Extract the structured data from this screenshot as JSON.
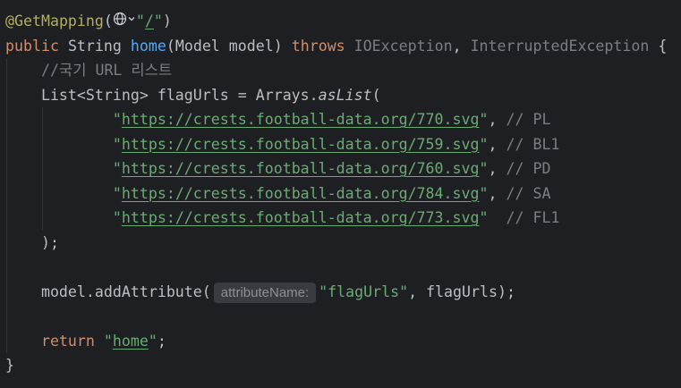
{
  "theme": {
    "background": "#1e1f22",
    "text": "#bcbec4",
    "keyword": "#cf8e6d",
    "method": "#56a8f5",
    "string": "#6aab73",
    "comment": "#7a7e85",
    "annotation": "#b3ae60",
    "unused": "#7a7e85",
    "inlay_bg": "#393b40",
    "inlay_text": "#8c8f94",
    "indent_guide": "#313438",
    "icon": "#ced0d6"
  },
  "icons": {
    "endpoint_actions": "globe-icon",
    "endpoint_dropdown": "chevron-down-icon"
  },
  "inlay_hint": "attributeName:",
  "lines": [
    [
      "@GetMapping",
      "(",
      "\"",
      "/",
      "\"",
      ")"
    ],
    [
      "public",
      " String ",
      "home",
      "(Model model) ",
      "throws",
      " IOException",
      ", ",
      "InterruptedException",
      " {"
    ],
    [
      "//국기 URL 리스트"
    ],
    [
      "List<String> flagUrls = Arrays.",
      "asList",
      "("
    ],
    [
      "\"",
      "https://crests.football-data.org/770.svg",
      "\"",
      ", ",
      "// PL"
    ],
    [
      "\"",
      "https://crests.football-data.org/759.svg",
      "\"",
      ", ",
      "// BL1"
    ],
    [
      "\"",
      "https://crests.football-data.org/760.svg",
      "\"",
      ", ",
      "// PD"
    ],
    [
      "\"",
      "https://crests.football-data.org/784.svg",
      "\"",
      ", ",
      "// SA"
    ],
    [
      "\"",
      "https://crests.football-data.org/773.svg",
      "\"",
      "  ",
      "// FL1"
    ],
    [
      ");"
    ],
    [],
    [
      "model.addAttribute(",
      "\"flagUrls\"",
      ", flagUrls);"
    ],
    [],
    [
      "return",
      " \"",
      "home",
      "\"",
      ";"
    ],
    [
      "}"
    ]
  ]
}
